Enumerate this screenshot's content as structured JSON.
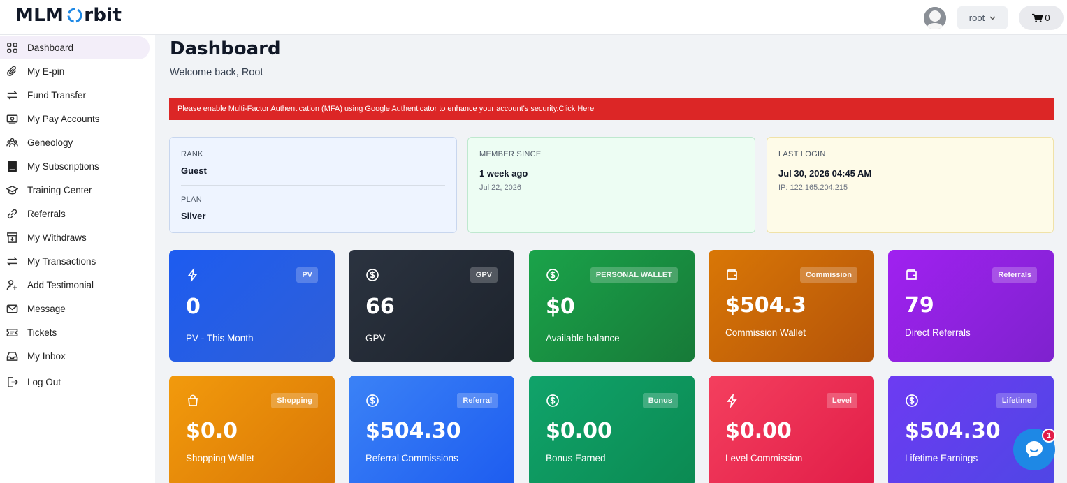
{
  "brand": {
    "logo_left": "MLM",
    "logo_right": "rbit"
  },
  "topbar": {
    "username": "root",
    "cart_count": "0"
  },
  "sidebar": {
    "items": [
      {
        "label": "Dashboard",
        "icon": "grid-icon"
      },
      {
        "label": "My E-pin",
        "icon": "paperclip-icon"
      },
      {
        "label": "Fund Transfer",
        "icon": "transfer-arrows-icon"
      },
      {
        "label": "My Pay Accounts",
        "icon": "money-icon"
      },
      {
        "label": "Geneology",
        "icon": "users-icon"
      },
      {
        "label": "My Subscriptions",
        "icon": "book-icon"
      },
      {
        "label": "Training Center",
        "icon": "graduation-cap-icon"
      },
      {
        "label": "Referrals",
        "icon": "link-icon"
      },
      {
        "label": "My Withdraws",
        "icon": "archive-icon"
      },
      {
        "label": "My Transactions",
        "icon": "transfer-arrows-icon"
      },
      {
        "label": "Add Testimonial",
        "icon": "user-plus-icon"
      },
      {
        "label": "Message",
        "icon": "envelope-icon"
      },
      {
        "label": "Tickets",
        "icon": "ticket-icon"
      },
      {
        "label": "My Inbox",
        "icon": "inbox-icon"
      },
      {
        "label": "Log Out",
        "icon": "logout-icon"
      }
    ]
  },
  "main": {
    "title": "Dashboard",
    "subtitle": "Welcome back, Root",
    "alert": "Please enable Multi-Factor Authentication (MFA) using Google Authenticator to enhance your account's security.Click Here"
  },
  "info": {
    "rank_label": "RANK",
    "rank_value": "Guest",
    "plan_label": "PLAN",
    "plan_value": "Silver",
    "member_label": "MEMBER SINCE",
    "member_value": "1 week ago",
    "member_date": "Jul 22, 2026",
    "login_label": "LAST LOGIN",
    "login_value": "Jul 30, 2026 04:45 AM",
    "login_ip": "IP: 122.165.204.215"
  },
  "stats": [
    {
      "badge": "PV",
      "value": "0",
      "caption": "PV - This Month",
      "icon": "bolt-icon",
      "colors": [
        "#1d5cf0",
        "#2f5fd8"
      ]
    },
    {
      "badge": "GPV",
      "value": "66",
      "caption": "GPV",
      "icon": "dollar-circle-icon",
      "colors": [
        "#2b3340",
        "#1d232c"
      ]
    },
    {
      "badge": "PERSONAL WALLET",
      "value": "$0",
      "caption": "Available balance",
      "icon": "dollar-circle-icon",
      "colors": [
        "#1aa34a",
        "#177a38"
      ]
    },
    {
      "badge": "Commission",
      "value": "$504.3",
      "caption": "Commission Wallet",
      "icon": "wallet-icon",
      "colors": [
        "#d97706",
        "#b45309"
      ]
    },
    {
      "badge": "Referrals",
      "value": "79",
      "caption": "Direct Referrals",
      "icon": "wallet-icon",
      "colors": [
        "#a021f0",
        "#7e22ce"
      ]
    },
    {
      "badge": "Shopping",
      "value": "$0.0",
      "caption": "Shopping Wallet",
      "icon": "bag-icon",
      "colors": [
        "#f29a0c",
        "#d97706"
      ]
    },
    {
      "badge": "Referral",
      "value": "$504.30",
      "caption": "Referral Commissions",
      "icon": "dollar-circle-icon",
      "colors": [
        "#3b82f6",
        "#1d5cf0"
      ]
    },
    {
      "badge": "Bonus",
      "value": "$0.00",
      "caption": "Bonus Earned",
      "icon": "dollar-circle-icon",
      "colors": [
        "#10a36a",
        "#0b8a52"
      ]
    },
    {
      "badge": "Level",
      "value": "$0.00",
      "caption": "Level Commission",
      "icon": "bolt-icon",
      "colors": [
        "#f43f5e",
        "#e11d48"
      ]
    },
    {
      "badge": "Lifetime",
      "value": "$504.30",
      "caption": "Lifetime Earnings",
      "icon": "dollar-circle-icon",
      "colors": [
        "#6d3bf2",
        "#4f46e5"
      ]
    }
  ],
  "chat": {
    "badge": "1"
  }
}
